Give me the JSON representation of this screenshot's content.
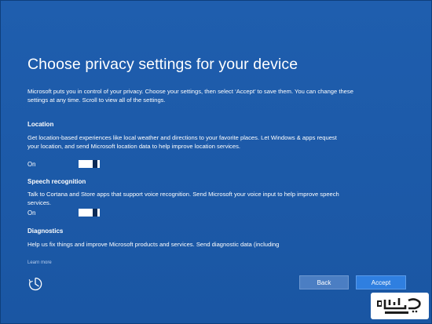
{
  "title": "Choose privacy settings for your device",
  "intro": "Microsoft puts you in control of your privacy. Choose your settings, then select ‘Accept’ to save them. You can change these settings at any time. Scroll to view all of the settings.",
  "sections": [
    {
      "heading": "Location",
      "text": "Get location-based experiences like local weather and directions to your favorite places. Let Windows & apps request your location, and send Microsoft location data to help improve location services.",
      "toggle_label": "On",
      "toggle_on": true
    },
    {
      "heading": "Speech recognition",
      "text": "Talk to Cortana and Store apps that support voice recognition. Send Microsoft your voice input to help improve speech services.",
      "toggle_label": "On",
      "toggle_on": true
    },
    {
      "heading": "Diagnostics",
      "text": "Help us fix things and improve Microsoft products and services. Send diagnostic data (including"
    }
  ],
  "learn_more": "Learn more",
  "buttons": {
    "back": "Back",
    "accept": "Accept"
  },
  "icons": {
    "ease_of_access": "ease-of-access-icon",
    "watermark": "click-ir-logo"
  },
  "colors": {
    "background": "#1c5aa8",
    "accept_button": "#2f7fe0",
    "back_button": "#4b7ec3",
    "toggle_knob": "#0c2a56"
  },
  "watermark_text": "کلیک CLICK.IR"
}
